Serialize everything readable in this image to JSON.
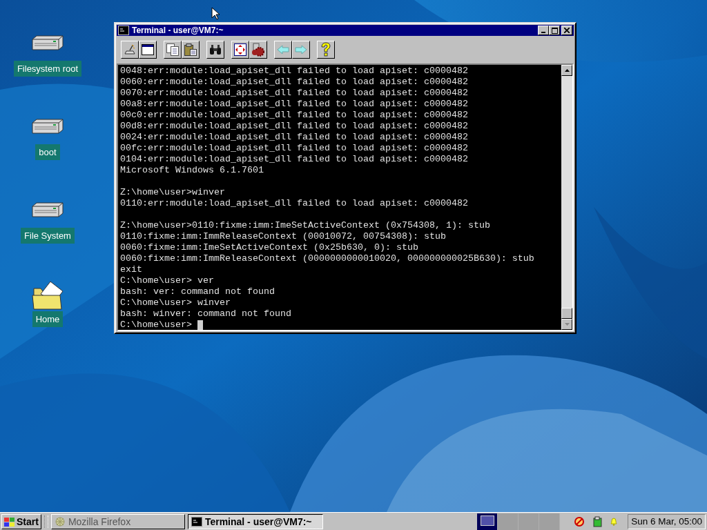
{
  "desktop_icons": [
    {
      "label": "Filesystem root",
      "kind": "drive"
    },
    {
      "label": "boot",
      "kind": "drive"
    },
    {
      "label": "File System",
      "kind": "drive"
    },
    {
      "label": "Home",
      "kind": "folder"
    }
  ],
  "window": {
    "title": "Terminal - user@VM7:~",
    "output": [
      [
        "0048:err:module:load_apiset_dll failed to load apiset: c0000482",
        "0060:err:module:load_apiset_dll failed to load apiset: c0000482",
        "0070:err:module:load_apiset_dll failed to load apiset: c0000482",
        "00a8:err:module:load_apiset_dll failed to load apiset: c0000482",
        "00c0:err:module:load_apiset_dll failed to load apiset: c0000482",
        "00d8:err:module:load_apiset_dll failed to load apiset: c0000482",
        "0024:err:module:load_apiset_dll failed to load apiset: c0000482",
        "00fc:err:module:load_apiset_dll failed to load apiset: c0000482",
        "0104:err:module:load_apiset_dll failed to load apiset: c0000482",
        "Microsoft Windows 6.1.7601"
      ],
      [
        "Z:\\home\\user>winver",
        "0110:err:module:load_apiset_dll failed to load apiset: c0000482"
      ],
      [
        "Z:\\home\\user>0110:fixme:imm:ImeSetActiveContext (0x754308, 1): stub",
        "0110:fixme:imm:ImmReleaseContext (00010072, 00754308): stub",
        "0060:fixme:imm:ImeSetActiveContext (0x25b630, 0): stub",
        "0060:fixme:imm:ImmReleaseContext (0000000000010020, 000000000025B630): stub",
        "exit",
        "C:\\home\\user> ver",
        "bash: ver: command not found",
        "C:\\home\\user> winver",
        "bash: winver: command not found",
        "C:\\home\\user> "
      ]
    ]
  },
  "taskbar": {
    "start": "Start",
    "tasks": [
      {
        "label": "Mozilla Firefox",
        "kind": "browser",
        "selected": false
      },
      {
        "label": "Terminal - user@VM7:~",
        "kind": "terminal",
        "selected": true
      }
    ],
    "desktops": [
      {
        "selected": true
      },
      {
        "selected": false
      },
      {
        "selected": false
      },
      {
        "selected": false
      }
    ],
    "clock": "Sun 6 Mar, 05:00"
  }
}
